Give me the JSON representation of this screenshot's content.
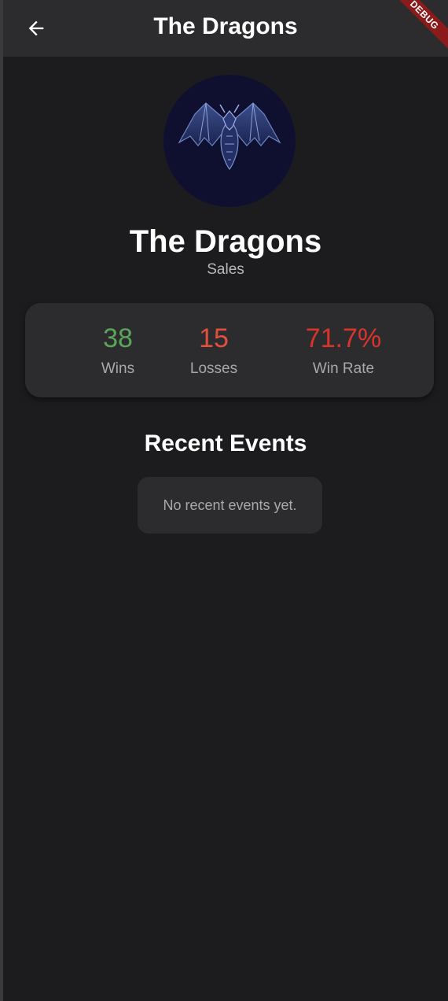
{
  "appbar": {
    "title": "The Dragons",
    "back_icon": "arrow-left-icon",
    "debug_label": "DEBUG"
  },
  "team": {
    "name": "The Dragons",
    "department": "Sales",
    "avatar_icon": "dragon-logo-icon"
  },
  "stats": [
    {
      "value": "38",
      "label": "Wins",
      "color": "#5aa55a"
    },
    {
      "value": "15",
      "label": "Losses",
      "color": "#e0503c"
    },
    {
      "value": "71.7%",
      "label": "Win Rate",
      "color": "#d8342c"
    }
  ],
  "events": {
    "title": "Recent Events",
    "empty_message": "No recent events yet."
  },
  "colors": {
    "background": "#1c1c1e",
    "appbar": "#2c2c2e",
    "card": "#2c2c2e",
    "debug_ribbon": "#8b1a1a"
  }
}
